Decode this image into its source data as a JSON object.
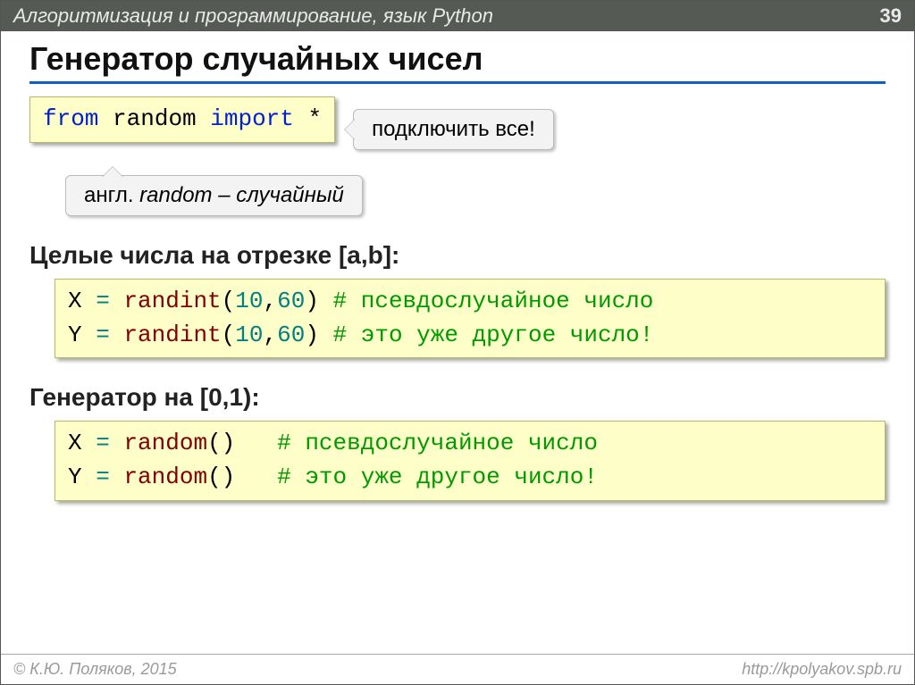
{
  "header": {
    "title": "Алгоритмизация и программирование, язык Python",
    "page": "39"
  },
  "title": "Генератор случайных чисел",
  "import_code": {
    "kw_from": "from",
    "module": "random",
    "kw_import": "import",
    "star": "*"
  },
  "callout_connect": "подключить все!",
  "callout_random": {
    "prefix": "англ.",
    "word": "random",
    "dash": "–",
    "meaning": "случайный"
  },
  "section_int": "Целые числа на отрезке [a,b]:",
  "int_code": {
    "l1_lhs": "X",
    "l1_eq": "=",
    "l1_fn": "randint",
    "l1_open": "(",
    "l1_a": "10",
    "l1_comma": ",",
    "l1_b": "60",
    "l1_close": ")",
    "l1_cm": "# псевдослучайное число",
    "l2_lhs": "Y",
    "l2_eq": "=",
    "l2_fn": "randint",
    "l2_open": "(",
    "l2_a": "10",
    "l2_comma": ",",
    "l2_b": "60",
    "l2_close": ")",
    "l2_cm": "# это уже другое число!"
  },
  "section_rand": "Генератор на [0,1):",
  "rand_code": {
    "l1_lhs": "X",
    "l1_eq": "=",
    "l1_fn": "random",
    "l1_par": "()",
    "l1_sp": "  ",
    "l1_cm": "# псевдослучайное число",
    "l2_lhs": "Y",
    "l2_eq": "=",
    "l2_fn": "random",
    "l2_par": "()",
    "l2_sp": "  ",
    "l2_cm": "# это уже другое число!"
  },
  "footer": {
    "left": "© К.Ю. Поляков, 2015",
    "right": "http://kpolyakov.spb.ru"
  }
}
